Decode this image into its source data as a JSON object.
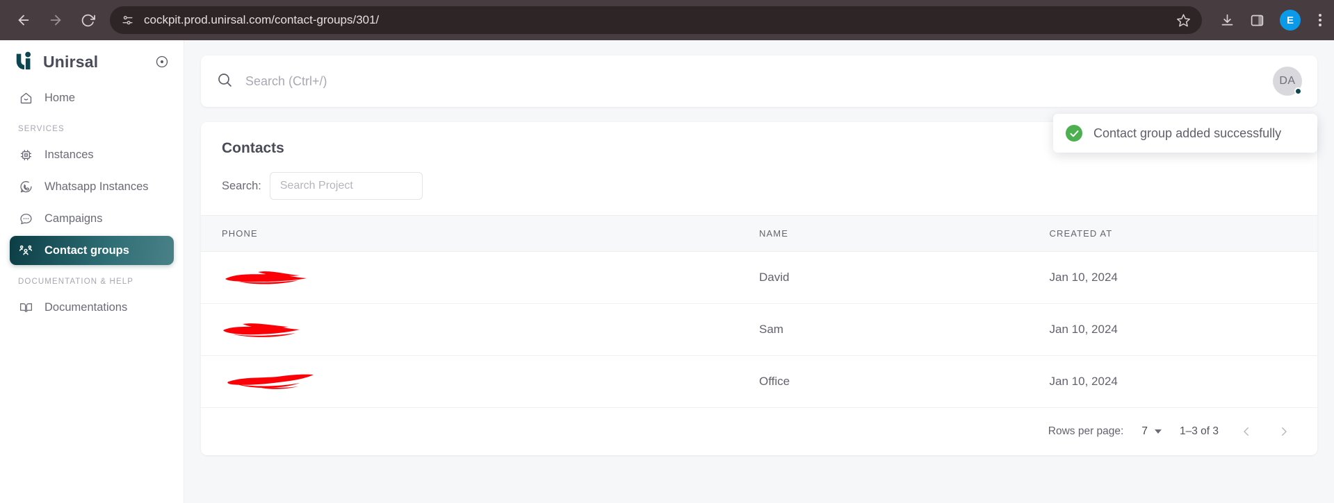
{
  "browser": {
    "back_icon": "back-arrow-icon",
    "forward_icon": "forward-arrow-icon",
    "reload_icon": "reload-icon",
    "site_info_icon": "site-settings-icon",
    "url": "cockpit.prod.unirsal.com/contact-groups/301/",
    "bookmark_icon": "star-icon",
    "download_icon": "download-icon",
    "side_panel_icon": "side-panel-icon",
    "profile_initial": "E",
    "profile_color": "#0b9ae8",
    "menu_icon": "three-dot-menu-icon"
  },
  "sidebar": {
    "brand": "Unirsal",
    "collapse_icon": "collapse-sidebar-icon",
    "items": [
      {
        "label": "Home",
        "icon": "home-icon",
        "active": false
      },
      {
        "label": "Instances",
        "icon": "chip-icon",
        "active": false
      },
      {
        "label": "Whatsapp Instances",
        "icon": "whatsapp-icon",
        "active": false
      },
      {
        "label": "Campaigns",
        "icon": "chat-bubble-icon",
        "active": false
      },
      {
        "label": "Contact groups",
        "icon": "people-group-icon",
        "active": true
      },
      {
        "label": "Documentations",
        "icon": "book-icon",
        "active": false
      }
    ],
    "sections": {
      "services": "SERVICES",
      "documentation": "DOCUMENTATION & HELP"
    },
    "active_gradient_from": "#0c3d45",
    "active_gradient_to": "#4a8187"
  },
  "topbar": {
    "search_placeholder": "Search (Ctrl+/)",
    "search_value": "",
    "search_icon": "search-icon",
    "avatar_initials": "DA",
    "avatar_status_color": "#0d4650"
  },
  "toast": {
    "message": "Contact group added successfully",
    "icon": "check-circle-icon",
    "icon_color": "#4caf50"
  },
  "card": {
    "title": "Contacts",
    "filter_label": "Search:",
    "filter_placeholder": "Search Project",
    "filter_value": "",
    "columns": [
      "PHONE",
      "NAME",
      "CREATED AT"
    ],
    "rows": [
      {
        "phone": "",
        "phone_redacted": true,
        "name": "David",
        "created_at": "Jan 10, 2024"
      },
      {
        "phone": "",
        "phone_redacted": true,
        "name": "Sam",
        "created_at": "Jan 10, 2024"
      },
      {
        "phone": "",
        "phone_redacted": true,
        "name": "Office",
        "created_at": "Jan 10, 2024"
      }
    ]
  },
  "pagination": {
    "rows_per_page_label": "Rows per page:",
    "rows_per_page_value": "7",
    "range_label": "1–3 of 3",
    "prev_icon": "chevron-left-icon",
    "next_icon": "chevron-right-icon"
  }
}
